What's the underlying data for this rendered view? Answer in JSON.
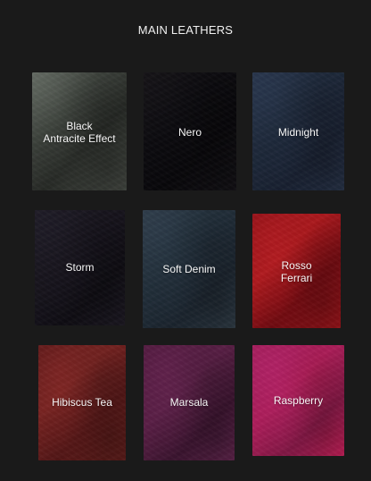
{
  "header": {
    "title": "MAIN LEATHERS"
  },
  "swatches": [
    {
      "label": "Black\nAntracite Effect"
    },
    {
      "label": "Nero"
    },
    {
      "label": "Midnight"
    },
    {
      "label": "Storm"
    },
    {
      "label": "Soft Denim"
    },
    {
      "label": "Rosso\nFerrari"
    },
    {
      "label": "Hibiscus Tea"
    },
    {
      "label": "Marsala"
    },
    {
      "label": "Raspberry"
    }
  ]
}
